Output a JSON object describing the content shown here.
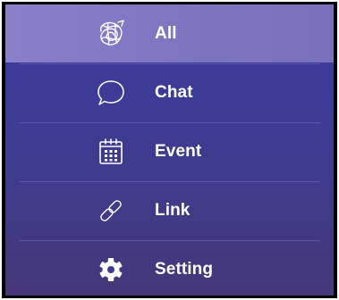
{
  "menu": {
    "selected_index": 0,
    "items": [
      {
        "label": "All",
        "icon": "doodle-ball-icon"
      },
      {
        "label": "Chat",
        "icon": "speech-bubble-icon"
      },
      {
        "label": "Event",
        "icon": "calendar-icon"
      },
      {
        "label": "Link",
        "icon": "chain-link-icon"
      },
      {
        "label": "Setting",
        "icon": "gear-icon"
      }
    ]
  },
  "colors": {
    "background_top": "#3a3a9e",
    "background_bottom": "#463778",
    "selected_highlight": "#8a7fc9",
    "text": "#ffffff"
  }
}
